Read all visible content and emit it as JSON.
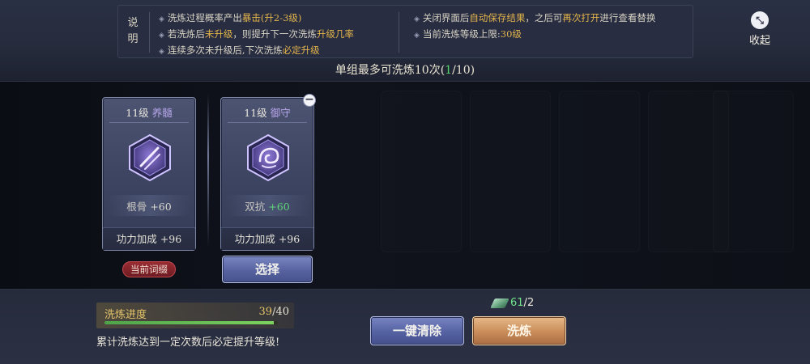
{
  "info": {
    "title": "说明",
    "left_lines": [
      {
        "pre": "洗炼过程概率产出",
        "hl": "暴击(升2-3级)",
        "post": ""
      },
      {
        "pre": "若洗炼后",
        "hl": "未升级",
        "post": "，则提升下一次洗炼",
        "hl2": "升级几率"
      },
      {
        "pre": "连续多次未升级后,下次洗炼",
        "hl": "必定升级",
        "post": ""
      }
    ],
    "right_lines": [
      {
        "pre": "关闭界面后",
        "hl": "自动保存结果",
        "post": "，之后可",
        "hl2": "再次打开",
        "post2": "进行查看替换"
      },
      {
        "pre": "当前洗炼等级上限:",
        "hl": "30级",
        "post": ""
      }
    ]
  },
  "collapse_label": "收起",
  "max_times": {
    "pre": "单组最多可洗炼10次(",
    "current": "1",
    "post": "/10)"
  },
  "cards": [
    {
      "level": "11级",
      "name": "养髓",
      "stat_label": "根骨",
      "stat_value": "+60",
      "stat_color": "#dcd9cf",
      "footer_label": "功力加成",
      "footer_value": "+96",
      "icon": "crossed-bones-icon"
    },
    {
      "level": "11级",
      "name": "御守",
      "stat_label": "双抗",
      "stat_value": "+60",
      "stat_color": "#5fd47a",
      "footer_label": "功力加成",
      "footer_value": "+96",
      "icon": "shield-swirl-icon"
    }
  ],
  "current_badge": "当前词缀",
  "select_label": "选择",
  "progress": {
    "label": "洗炼进度",
    "current": "39",
    "total": "40",
    "fraction": 0.975
  },
  "progress_hint": "累计洗炼达到一定次数后必定提升等级!",
  "currency": {
    "current": "61",
    "cost": "2",
    "icon": "jade-gem-icon"
  },
  "buttons": {
    "clear": "一键清除",
    "refine": "洗炼"
  }
}
